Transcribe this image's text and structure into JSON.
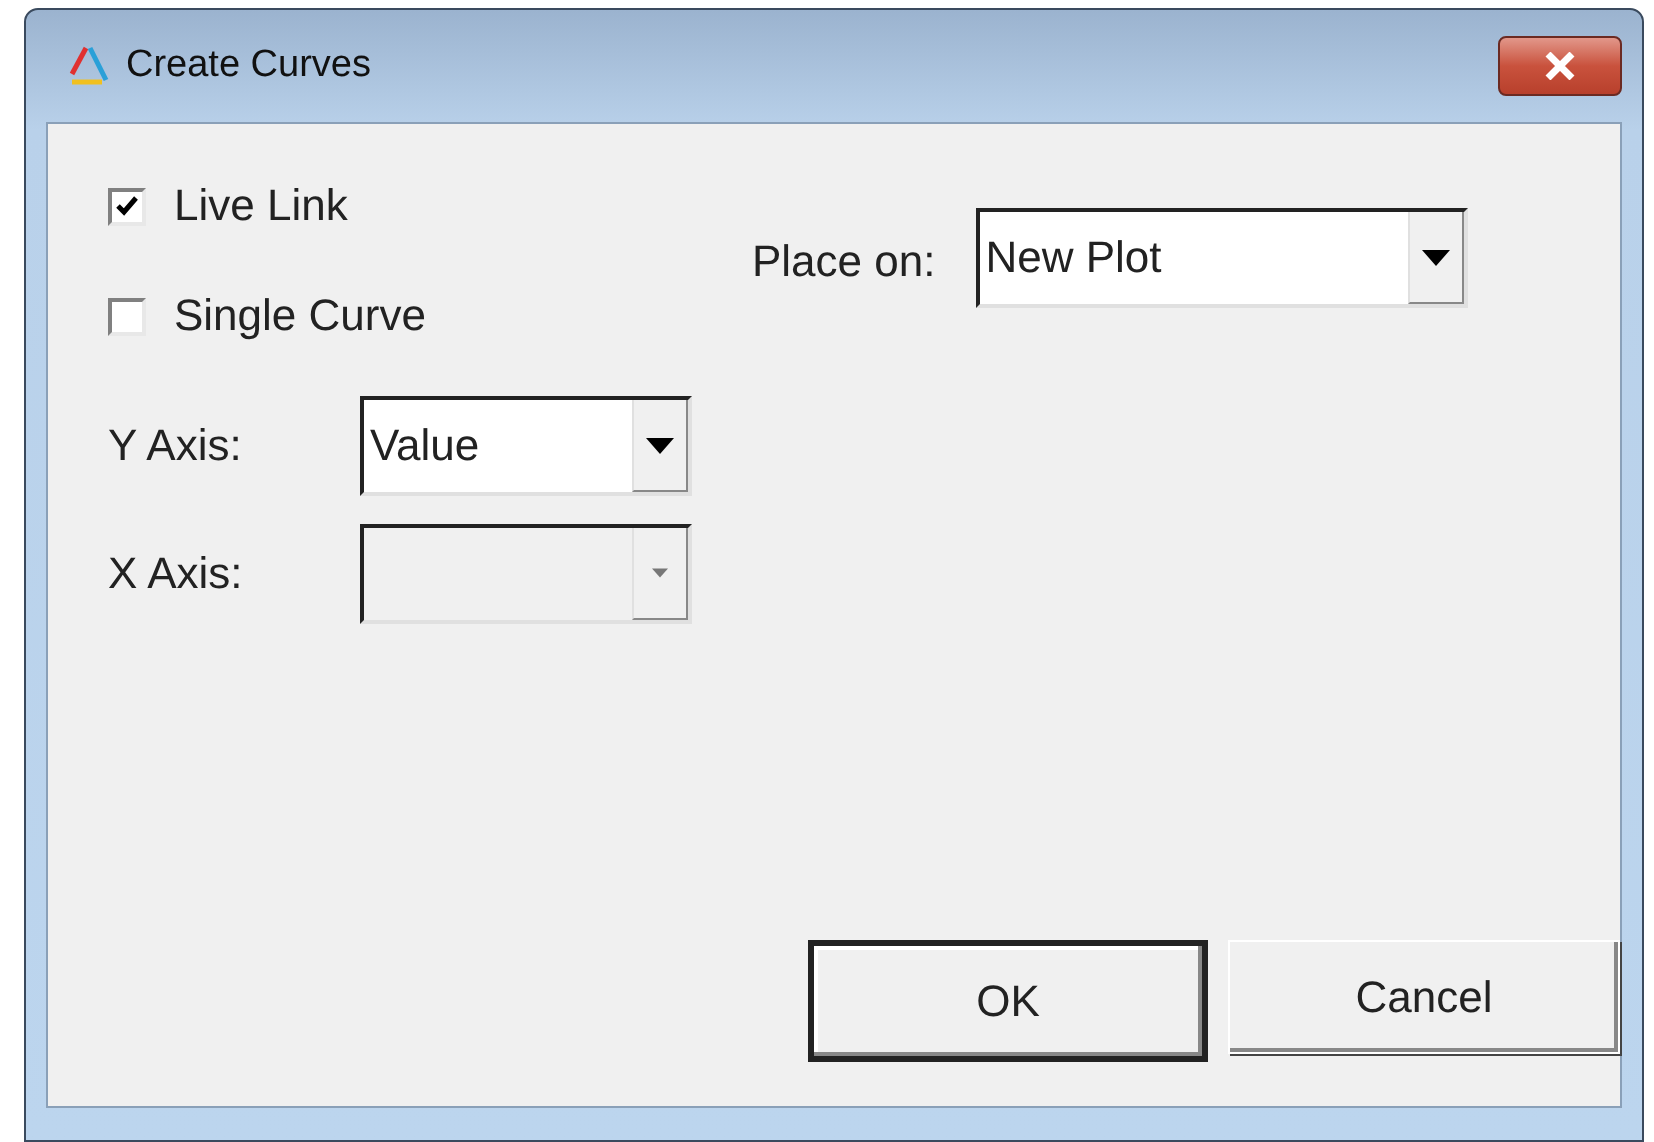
{
  "window": {
    "title": "Create Curves"
  },
  "checkboxes": [
    {
      "label": "Live Link",
      "checked": true
    },
    {
      "label": "Single Curve",
      "checked": false
    }
  ],
  "axes": [
    {
      "label": "Y Axis:",
      "value": "Value",
      "disabled": false
    },
    {
      "label": "X Axis:",
      "disabled": true
    }
  ],
  "place_on": {
    "label": "Place on:",
    "value": "New Plot"
  },
  "buttons": [
    {
      "label": "OK",
      "default": true
    },
    {
      "label": "Cancel",
      "default": false
    }
  ]
}
